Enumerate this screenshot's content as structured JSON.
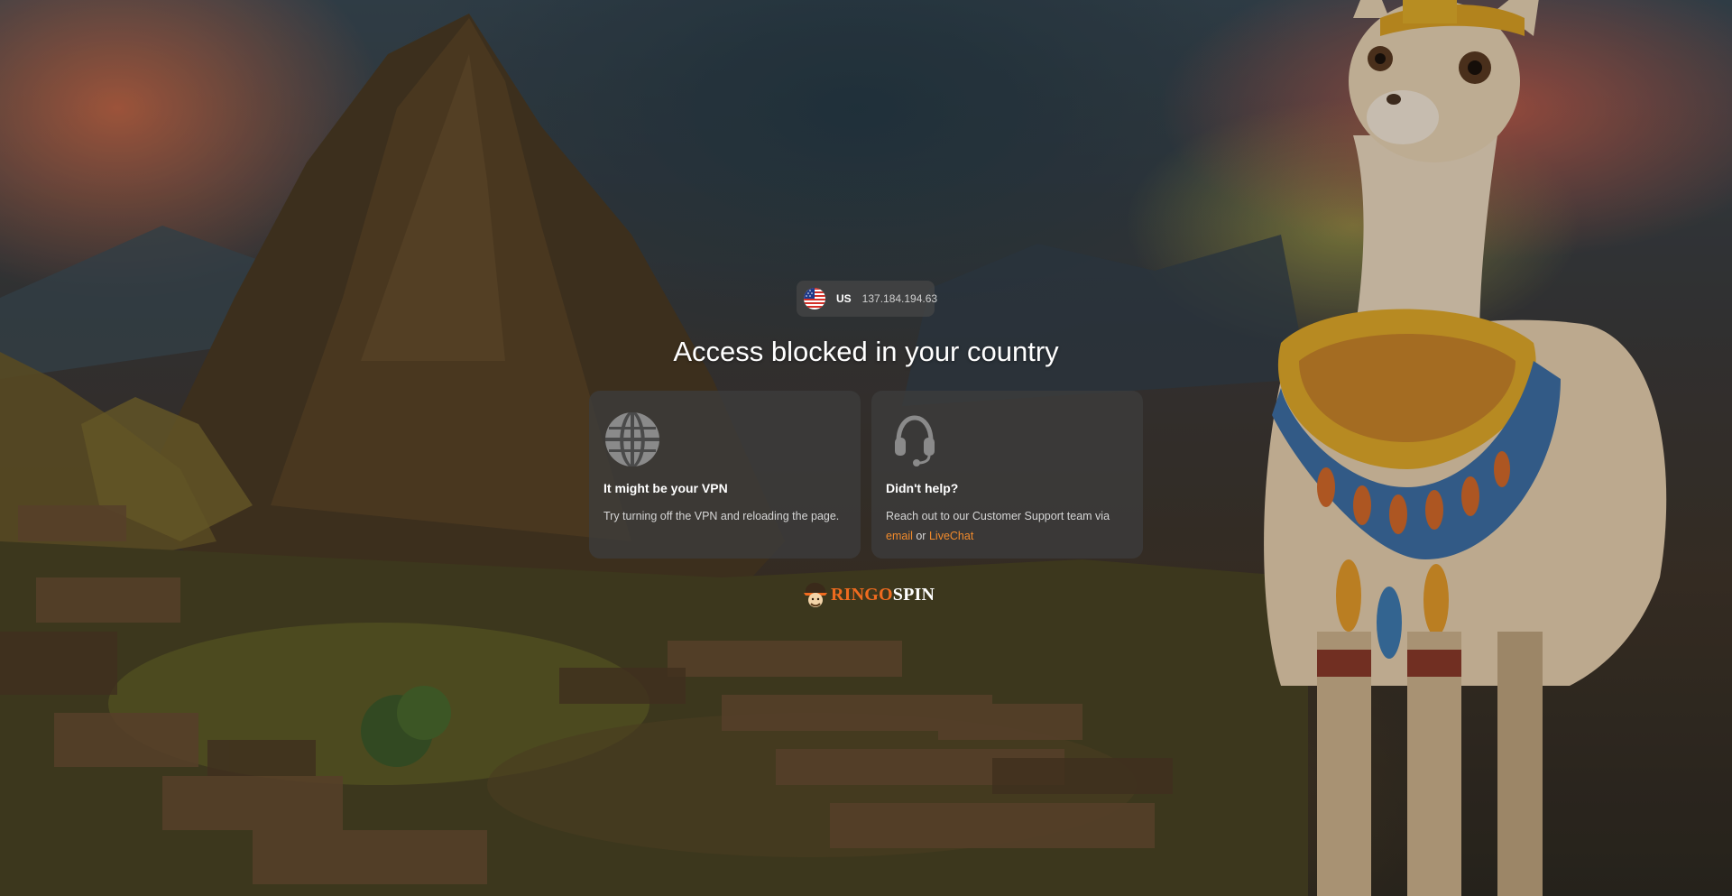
{
  "geo": {
    "country_code": "US",
    "ip": "137.184.194.63",
    "flag_icon": "us-flag-icon"
  },
  "headline": "Access blocked in your country",
  "cards": [
    {
      "icon": "globe-icon",
      "title": "It might be your VPN",
      "text": "Try turning off the VPN and reloading the page."
    },
    {
      "icon": "headset-icon",
      "title": "Didn't help?",
      "text_before": "Reach out to our Customer Support team via",
      "link_email": "email",
      "connector": "or",
      "link_livechat": "LiveChat"
    }
  ],
  "brand": {
    "part1": "RINGO",
    "part2": "SPIN"
  },
  "colors": {
    "accent": "#f08a2c",
    "brand_orange": "#ef6b1f"
  }
}
